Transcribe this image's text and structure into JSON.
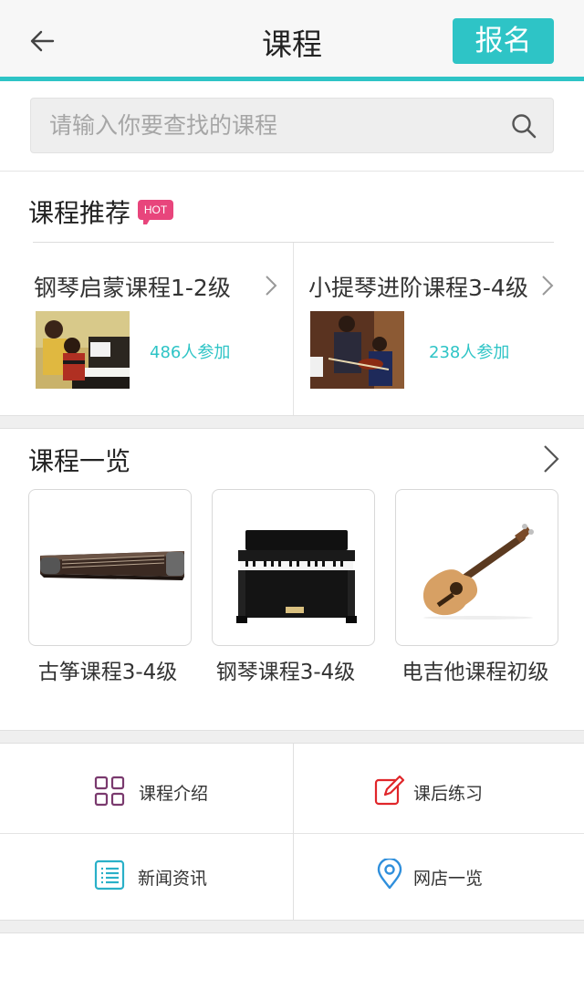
{
  "header": {
    "title": "课程",
    "signup_label": "报名",
    "back_icon": "arrow-left-icon"
  },
  "search": {
    "placeholder": "请输入你要查找的课程",
    "value": "",
    "icon": "search-icon"
  },
  "recommend": {
    "title": "课程推荐",
    "badge": "HOT",
    "items": [
      {
        "name": "钢琴启蒙课程1-2级",
        "count": "486人参加",
        "image": "piano-lesson-photo"
      },
      {
        "name": "小提琴进阶课程3-4级",
        "count": "238人参加",
        "image": "violin-lesson-photo"
      }
    ]
  },
  "courses": {
    "title": "课程一览",
    "items": [
      {
        "name": "古筝课程3-4级",
        "image": "guzheng-image"
      },
      {
        "name": "钢琴课程3-4级",
        "image": "piano-image"
      },
      {
        "name": "电吉他课程初级",
        "image": "guitar-image"
      }
    ]
  },
  "menu": [
    {
      "label": "课程介绍",
      "icon": "grid-icon",
      "color": "#7a3a6e"
    },
    {
      "label": "课后练习",
      "icon": "edit-icon",
      "color": "#e0262a"
    },
    {
      "label": "新闻资讯",
      "icon": "list-icon",
      "color": "#2ab0c8"
    },
    {
      "label": "网店一览",
      "icon": "location-pin-icon",
      "color": "#2f8fdc"
    }
  ],
  "colors": {
    "accent": "#2ec4c6",
    "hot": "#e8457c"
  }
}
